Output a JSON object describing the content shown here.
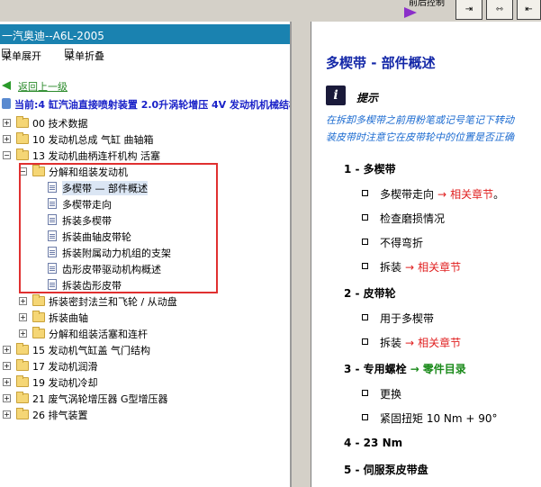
{
  "toolbar": {
    "partial_text": "前后控制",
    "btn1_glyph": "⇥",
    "btn2_glyph": "⇿",
    "btn3_glyph": "⇤"
  },
  "left": {
    "title": "一汽奥迪--A6L-2005",
    "menu_expand": "菜单展开",
    "menu_collapse": "菜单折叠",
    "back_link": "返回上一级",
    "current": "当前:4 缸汽油直接喷射装置 2.0升涡轮增压 4V 发动机机械结构",
    "tree": [
      {
        "label": "00 技术数据",
        "exp": "+",
        "type": "folder"
      },
      {
        "label": "10 发动机总成 气缸 曲轴箱",
        "exp": "+",
        "type": "folder"
      },
      {
        "label": "13 发动机曲柄连杆机构 活塞",
        "exp": "−",
        "type": "folder"
      },
      {
        "label": "分解和组装发动机",
        "exp": "−",
        "type": "folder"
      },
      {
        "label": "多楔带 — 部件概述",
        "exp": "",
        "type": "doc",
        "selected": true
      },
      {
        "label": "多楔带走向",
        "exp": "",
        "type": "doc"
      },
      {
        "label": "拆装多楔带",
        "exp": "",
        "type": "doc"
      },
      {
        "label": "拆装曲轴皮带轮",
        "exp": "",
        "type": "doc"
      },
      {
        "label": "拆装附属动力机组的支架",
        "exp": "",
        "type": "doc"
      },
      {
        "label": "齿形皮带驱动机构概述",
        "exp": "",
        "type": "doc"
      },
      {
        "label": "拆装齿形皮带",
        "exp": "",
        "type": "doc"
      },
      {
        "label": "拆装密封法兰和飞轮 / 从动盘",
        "exp": "+",
        "type": "folder"
      },
      {
        "label": "拆装曲轴",
        "exp": "+",
        "type": "folder"
      },
      {
        "label": "分解和组装活塞和连杆",
        "exp": "+",
        "type": "folder"
      },
      {
        "label": "15 发动机气缸盖 气门结构",
        "exp": "+",
        "type": "folder"
      },
      {
        "label": "17 发动机润滑",
        "exp": "+",
        "type": "folder"
      },
      {
        "label": "19 发动机冷却",
        "exp": "+",
        "type": "folder"
      },
      {
        "label": "21 废气涡轮增压器 G型增压器",
        "exp": "+",
        "type": "folder"
      },
      {
        "label": "26 排气装置",
        "exp": "+",
        "type": "folder"
      }
    ]
  },
  "right": {
    "title": "多楔带 - 部件概述",
    "hint_title": "提示",
    "hint_line1": "在拆卸多楔带之前用粉笔或记号笔记下转动",
    "hint_line2": "装皮带时注意它在皮带轮中的位置是否正确",
    "arrow": "→",
    "sections": [
      {
        "label": "1 - 多楔带",
        "items": [
          {
            "text": "多楔带走向",
            "link": "相关章节",
            "link_color": "red",
            "suffix": "。"
          },
          {
            "text": "检查磨损情况"
          },
          {
            "text": "不得弯折"
          },
          {
            "text": "拆装",
            "link": "相关章节",
            "link_color": "red"
          }
        ]
      },
      {
        "label": "2 - 皮带轮",
        "items": [
          {
            "text": "用于多楔带"
          },
          {
            "text": "拆装",
            "link": "相关章节",
            "link_color": "red"
          }
        ]
      },
      {
        "label": "3 - 专用螺栓",
        "link": "零件目录",
        "link_color": "green",
        "items": [
          {
            "text": "更换"
          },
          {
            "text": "紧固扭矩 10 Nm + 90°"
          }
        ]
      },
      {
        "label": "4 - 23 Nm",
        "items": []
      },
      {
        "label": "5 - 伺服泵皮带盘",
        "items": []
      }
    ]
  },
  "colors": {
    "title_bar": "#1a82b0",
    "link_blue": "#1428a8",
    "link_red": "#e02020",
    "link_green": "#1a8a1a",
    "highlight_box": "#e03030"
  }
}
